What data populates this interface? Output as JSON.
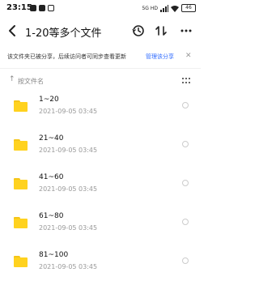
{
  "status_bar": {
    "time": "23:15",
    "network_text": "5G HD",
    "battery": "46"
  },
  "header": {
    "title": "1-20等多个文件"
  },
  "notice": {
    "text": "该文件夹已被分享，后续访问者可同步查看更新",
    "link": "管理该分享"
  },
  "sort_bar": {
    "label": "按文件名"
  },
  "files": [
    {
      "name": "1~20",
      "date": "2021-09-05  03:45"
    },
    {
      "name": "21~40",
      "date": "2021-09-05  03:45"
    },
    {
      "name": "41~60",
      "date": "2021-09-05  03:45"
    },
    {
      "name": "61~80",
      "date": "2021-09-05  03:45"
    },
    {
      "name": "81~100",
      "date": "2021-09-05  03:45"
    }
  ],
  "colors": {
    "accent": "#2f6bff",
    "folder": "#ffd21f"
  }
}
